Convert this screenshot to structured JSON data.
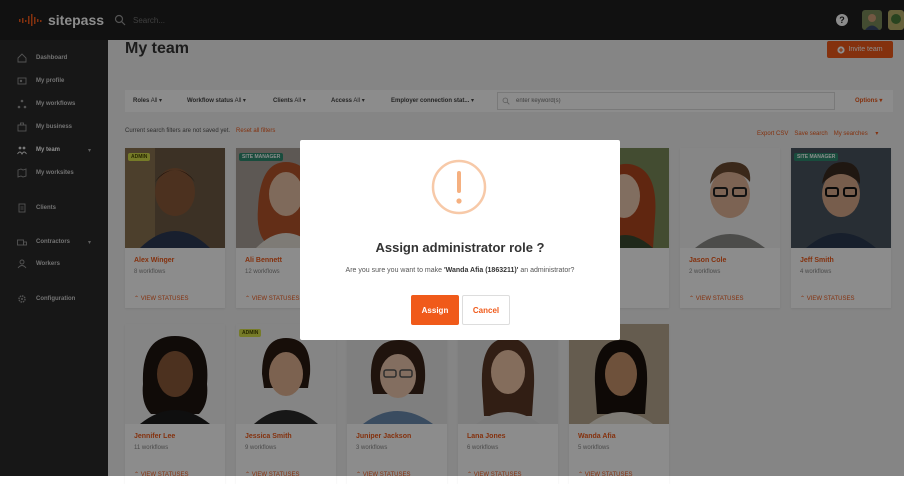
{
  "app": {
    "logo_text": "sitepass",
    "search_placeholder": "Search..."
  },
  "header": {
    "help_label": "?"
  },
  "sidebar": {
    "items": [
      {
        "label": "Dashboard",
        "icon": "home-icon"
      },
      {
        "label": "My profile",
        "icon": "profile-icon"
      },
      {
        "label": "My workflows",
        "icon": "workflow-icon"
      },
      {
        "label": "My business",
        "icon": "business-icon"
      },
      {
        "label": "My team",
        "icon": "team-icon",
        "active": true
      },
      {
        "label": "My worksites",
        "icon": "worksites-icon"
      },
      {
        "label": "Clients",
        "icon": "clients-icon"
      },
      {
        "label": "Contractors",
        "icon": "contractors-icon"
      },
      {
        "label": "Workers",
        "icon": "workers-icon"
      },
      {
        "label": "Configuration",
        "icon": "gear-icon"
      }
    ]
  },
  "page": {
    "title": "My team",
    "invite_label": "Invite team",
    "filters": [
      {
        "label": "Roles",
        "value": "All"
      },
      {
        "label": "Workflow status",
        "value": "All"
      },
      {
        "label": "Clients",
        "value": "All"
      },
      {
        "label": "Access",
        "value": "All"
      },
      {
        "label": "Employer connection stat...",
        "value": ""
      }
    ],
    "keyword_placeholder": "enter keyword(s)",
    "options_label": "Options",
    "notice": "Current search filters are not saved yet.",
    "reset_label": "Reset all filters",
    "export_label": "Export CSV",
    "save_search_label": "Save search",
    "my_searches_label": "My searches"
  },
  "cards": [
    {
      "name": "Alex Winger",
      "workflows": "8 workflows",
      "badge": "ADMIN",
      "view": "VIEW STATUSES"
    },
    {
      "name": "Ali Bennett",
      "workflows": "12 workflows",
      "badge": "SITE MANAGER",
      "view": "VIEW STATUSES"
    },
    {
      "name": "",
      "workflows": "",
      "badge": "",
      "view": ""
    },
    {
      "name": "",
      "workflows": "",
      "badge": "",
      "view": ""
    },
    {
      "name": "",
      "workflows": "",
      "badge": "",
      "view": ""
    },
    {
      "name": "Jason Cole",
      "workflows": "2 workflows",
      "badge": "",
      "view": "VIEW STATUSES"
    },
    {
      "name": "Jeff Smith",
      "workflows": "4 workflows",
      "badge": "SITE MANAGER",
      "view": "VIEW STATUSES"
    },
    {
      "name": "Jennifer Lee",
      "workflows": "11 workflows",
      "badge": "",
      "view": "VIEW STATUSES"
    },
    {
      "name": "Jessica Smith",
      "workflows": "9 workflows",
      "badge": "ADMIN",
      "view": "VIEW STATUSES"
    },
    {
      "name": "Juniper Jackson",
      "workflows": "3 workflows",
      "badge": "",
      "view": "VIEW STATUSES"
    },
    {
      "name": "Lana Jones",
      "workflows": "6 workflows",
      "badge": "",
      "view": "VIEW STATUSES"
    },
    {
      "name": "Wanda Afia",
      "workflows": "5 workflows",
      "badge": "",
      "view": "VIEW STATUSES"
    }
  ],
  "modal": {
    "title": "Assign administrator role ?",
    "message_prefix": "Are you sure you want to make",
    "message_target": "'Wanda Afia (1863211)'",
    "message_suffix": "an administrator?",
    "assign_label": "Assign",
    "cancel_label": "Cancel"
  },
  "colors": {
    "accent": "#f05a1a",
    "site_manager_badge": "#2e8b6f",
    "admin_badge": "#d7e04a"
  }
}
